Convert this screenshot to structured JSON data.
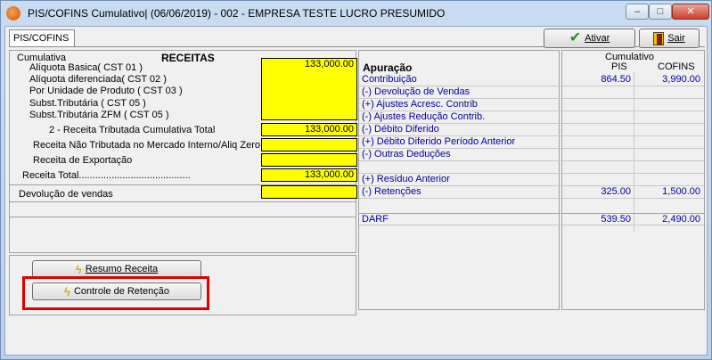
{
  "window": {
    "title": "PIS/COFINS Cumulativo| (06/06/2019) - 002 - EMPRESA TESTE LUCRO PRESUMIDO",
    "controls": {
      "minimize": "–",
      "maximize": "□",
      "close": "✕"
    }
  },
  "tabs": [
    {
      "label": "PIS/COFINS"
    }
  ],
  "toolbar": {
    "ativar_label": "Ativar",
    "sair_label": "Sair"
  },
  "receitas": {
    "section_label": "Cumulativa",
    "title": "RECEITAS",
    "items": [
      {
        "label": "Alíquota Basica( CST 01 )"
      },
      {
        "label": "Alíquota diferenciada( CST 02 )"
      },
      {
        "label": "Por Unidade de Produto ( CST 03 )"
      },
      {
        "label": "Subst.Tributária ( CST 05 )"
      },
      {
        "label": "Subst.Tributária ZFM ( CST 05 )"
      }
    ],
    "main_value": "133,000.00",
    "tributada_label": "2 - Receita Tributada Cumulativa Total",
    "tributada_value": "133,000.00",
    "nao_tributada_label": "Receita Não Tributada no Mercado Interno/Aliq Zero",
    "nao_tributada_value": "",
    "exportacao_label": "Receita de Exportação",
    "exportacao_value": "",
    "total_label": "Receita Total.........................................",
    "total_value": "133,000.00",
    "devolucao_label": "Devolução de vendas",
    "devolucao_value": ""
  },
  "buttons": {
    "resumo_label": "Resumo Receita",
    "controle_label": "Controle de Retenção"
  },
  "apuracao": {
    "title": "Apuração",
    "rows": [
      {
        "label": "Contribuição",
        "pis": "864.50",
        "cofins": "3,990.00"
      },
      {
        "label": "(-) Devolução de Vendas",
        "pis": "",
        "cofins": ""
      },
      {
        "label": "(+) Ajustes Acresc. Contrib",
        "pis": "",
        "cofins": ""
      },
      {
        "label": "(-) Ajustes Redução Contrib.",
        "pis": "",
        "cofins": ""
      },
      {
        "label": "(-) Débito Diferido",
        "pis": "",
        "cofins": ""
      },
      {
        "label": "(+) Débito Diferido Período  Anterior",
        "pis": "",
        "cofins": ""
      },
      {
        "label": "(-) Outras Deduções",
        "pis": "",
        "cofins": ""
      },
      {
        "label": "",
        "pis": "",
        "cofins": ""
      },
      {
        "label": "(+) Resíduo Anterior",
        "pis": "",
        "cofins": ""
      },
      {
        "label": "(-) Retenções",
        "pis": "325.00",
        "cofins": "1,500.00"
      }
    ],
    "darf": {
      "label": "DARF",
      "pis": "539.50",
      "cofins": "2,490.00"
    }
  },
  "cumulativo": {
    "header": "Cumulativo",
    "pis_label": "PIS",
    "cofins_label": "COFINS"
  }
}
